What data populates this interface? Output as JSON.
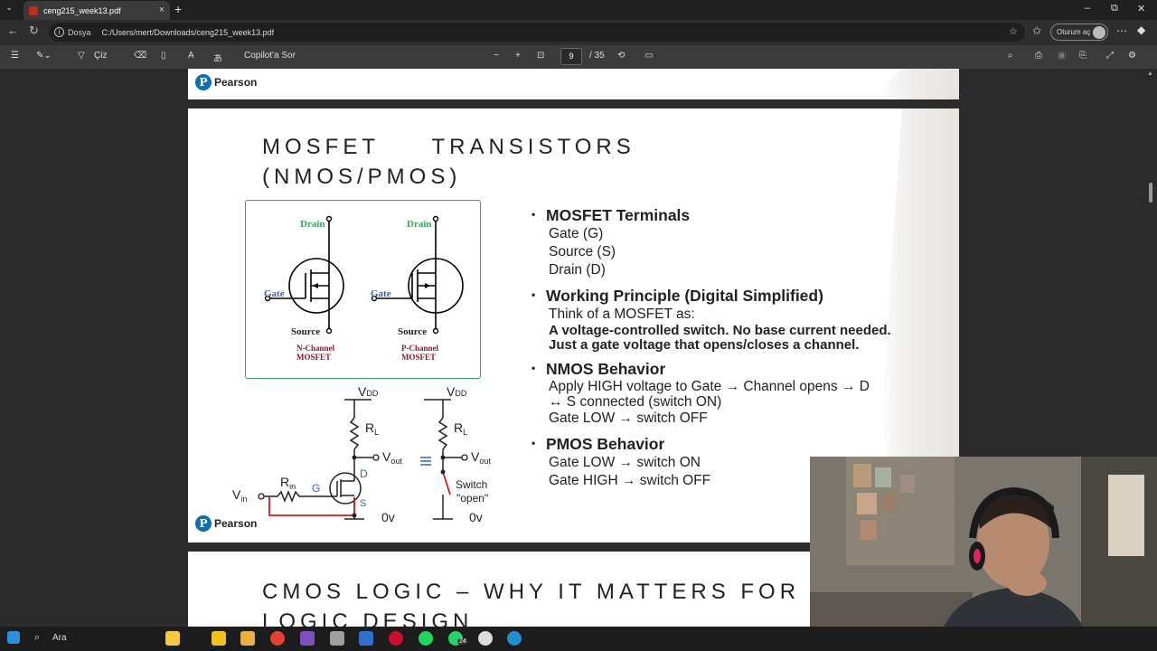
{
  "browser": {
    "tab_title": "ceng215_week13.pdf",
    "tab_close": "×",
    "new_tab": "+",
    "address_label": "Dosya",
    "address_url": "C:/Users/mert/Downloads/ceng215_week13.pdf",
    "profile_label": "Oturum aç",
    "window_min": "–",
    "window_max": "⧉",
    "window_close": "✕"
  },
  "pdf_toolbar": {
    "draw_label": "Çiz",
    "copilot_label": "Copilot'a Sor",
    "page_current": "9",
    "page_total": "/ 35",
    "zoom_out": "−",
    "zoom_in": "+"
  },
  "slide_header": {
    "brand": "Pearson"
  },
  "slide": {
    "title_line1": "MOSFET     TRANSISTORS",
    "title_line2": "(NMOS/PMOS)",
    "brand": "Pearson",
    "figure": {
      "n_drain": "Drain",
      "n_gate": "Gate",
      "n_source": "Source",
      "n_caption1": "N-Channel",
      "n_caption2": "MOSFET",
      "p_drain": "Drain",
      "p_gate": "Gate",
      "p_source": "Source",
      "p_caption1": "P-Channel",
      "p_caption2": "MOSFET"
    },
    "circuit": {
      "vdd1": "V",
      "vdd_sub": "DD",
      "rl": "R",
      "rl_sub": "L",
      "vout": "V",
      "vout_sub": "out",
      "vin": "V",
      "vin_sub": "in",
      "rin": "R",
      "rin_sub": "in",
      "g": "G",
      "d": "D",
      "s": "S",
      "zero1": "0v",
      "equiv": "≡",
      "switch1": "Switch",
      "switch2": "\"open\"",
      "zero2": "0v"
    },
    "bullets": [
      {
        "head": "MOSFET Terminals",
        "lines": [
          "Gate (G)",
          "Source (S)",
          "Drain (D)"
        ],
        "bold_lines": []
      },
      {
        "head": "Working Principle (Digital Simplified)",
        "lines": [
          "Think of a MOSFET as:"
        ],
        "bold_lines": [
          "A voltage-controlled switch. No base current needed.",
          "Just a gate voltage that opens/closes a channel."
        ]
      },
      {
        "head": "NMOS Behavior",
        "lines": [
          "Apply HIGH voltage to Gate → Channel opens → D",
          "↔ S connected (switch ON)",
          "Gate LOW → switch OFF"
        ],
        "bold_lines": []
      },
      {
        "head": "PMOS Behavior",
        "lines": [
          "Gate LOW → switch ON",
          "Gate HIGH → switch OFF"
        ],
        "bold_lines": []
      }
    ]
  },
  "next_slide": {
    "title_line1": "CMOS LOGIC – WHY IT MATTERS FOR",
    "title_line2": "LOGIC DESIGN"
  },
  "taskbar": {
    "search_label": "Ara",
    "badge": "24"
  }
}
